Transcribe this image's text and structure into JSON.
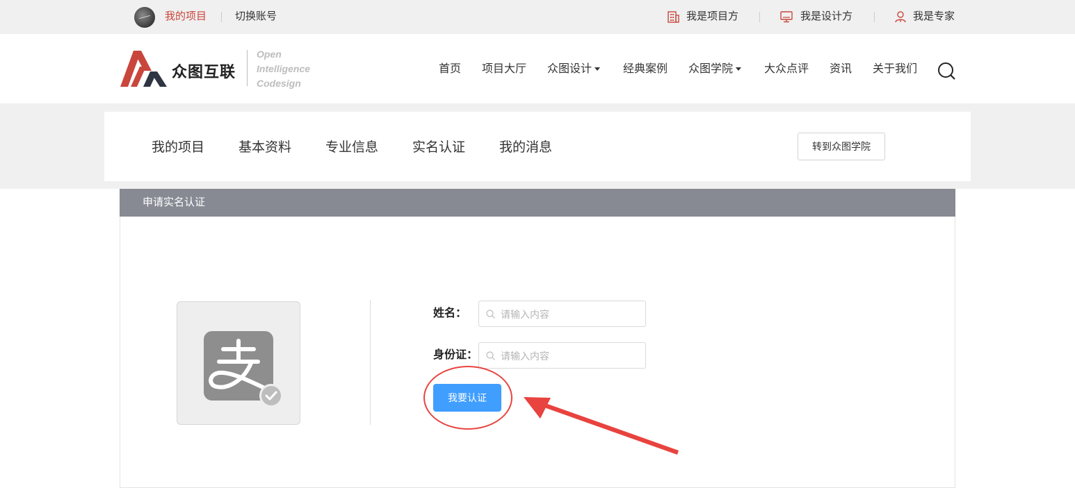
{
  "topbar": {
    "my_project": "我的项目",
    "switch_account": "切换账号",
    "role_client": "我是项目方",
    "role_designer": "我是设计方",
    "role_expert": "我是专家"
  },
  "header": {
    "logo_text": "众图互联",
    "logo_en": [
      "Open",
      "Intelligence",
      "Codesign"
    ],
    "nav": [
      "首页",
      "项目大厅",
      "众图设计",
      "经典案例",
      "众图学院",
      "大众点评",
      "资讯",
      "关于我们"
    ]
  },
  "subnav": {
    "tabs": [
      "我的项目",
      "基本资料",
      "专业信息",
      "实名认证",
      "我的消息"
    ],
    "goto_academy": "转到众图学院"
  },
  "panel": {
    "title": "申请实名认证",
    "name_label": "姓名：",
    "id_label": "身份证：",
    "placeholder": "请输入内容",
    "verify_button": "我要认证"
  },
  "icons": {
    "alipay": "alipay-icon",
    "check": "check-icon",
    "search": "search-icon"
  },
  "colors": {
    "accent_red": "#c9463d",
    "panel_header": "#878a93",
    "button_blue": "#409eff",
    "annotation_red": "#e8433f"
  }
}
